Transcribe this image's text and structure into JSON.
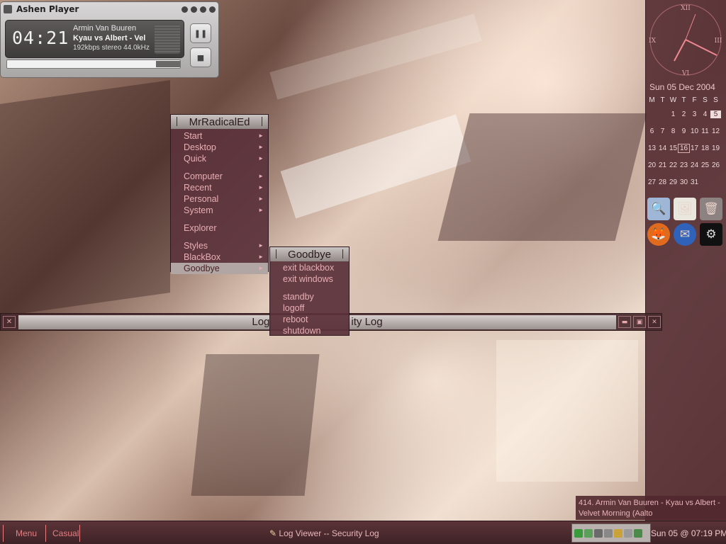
{
  "player": {
    "title": "Ashen Player",
    "time": "04:21",
    "artist": "Armin Van Buuren",
    "track": "Kyau vs Albert - Vel",
    "info": "192kbps stereo 44.0kHz",
    "pause_icon": "pause-icon",
    "stop_icon": "stop-icon",
    "progress": 0.86
  },
  "clock": {
    "numerals": {
      "top": "XII",
      "right": "III",
      "bottom": "VI",
      "left": "IX"
    },
    "date_label": "Sun 05 Dec 2004"
  },
  "calendar": {
    "weekdays": [
      "M",
      "T",
      "W",
      "T",
      "F",
      "S",
      "S"
    ],
    "weeks": [
      [
        "",
        "",
        "",
        "1",
        "2",
        "3",
        "4",
        "5"
      ],
      [
        "6",
        "7",
        "8",
        "9",
        "10",
        "11",
        "12"
      ],
      [
        "13",
        "14",
        "15",
        "16",
        "17",
        "18",
        "19"
      ],
      [
        "20",
        "21",
        "22",
        "23",
        "24",
        "25",
        "26"
      ],
      [
        "27",
        "28",
        "29",
        "30",
        "31",
        "",
        ""
      ]
    ],
    "today": "5",
    "marked": "16"
  },
  "dock": [
    {
      "name": "search-icon",
      "color": "#3a6fb5"
    },
    {
      "name": "image-viewer-icon",
      "color": "#e9e6dd"
    },
    {
      "name": "recycle-bin-icon",
      "color": "#cfcfcf"
    },
    {
      "name": "firefox-icon",
      "color": "#e06b1f"
    },
    {
      "name": "thunderbird-icon",
      "color": "#2f62b8"
    },
    {
      "name": "steam-icon",
      "color": "#111111"
    }
  ],
  "root_menu": {
    "title": "MrRadicalEd",
    "items": [
      {
        "label": "Start",
        "submenu": true
      },
      {
        "label": "Desktop",
        "submenu": true
      },
      {
        "label": "Quick",
        "submenu": true
      },
      {
        "separator": true
      },
      {
        "label": "Computer",
        "submenu": true
      },
      {
        "label": "Recent",
        "submenu": true
      },
      {
        "label": "Personal",
        "submenu": true
      },
      {
        "label": "System",
        "submenu": true
      },
      {
        "separator": true
      },
      {
        "label": "Explorer",
        "submenu": false
      },
      {
        "separator": true
      },
      {
        "label": "Styles",
        "submenu": true
      },
      {
        "label": "BlackBox",
        "submenu": true
      },
      {
        "label": "Goodbye",
        "submenu": true,
        "active": true
      }
    ]
  },
  "goodbye_menu": {
    "title": "Goodbye",
    "items": [
      {
        "label": "exit blackbox"
      },
      {
        "label": "exit windows"
      },
      {
        "separator": true
      },
      {
        "label": "standby"
      },
      {
        "label": "logoff"
      },
      {
        "label": "reboot"
      },
      {
        "label": "shutdown"
      }
    ]
  },
  "log_window": {
    "title_left": "Log",
    "title_right": "ity Log"
  },
  "ticker": {
    "text": "414. Armin Van Buuren - Kyau vs Albert - Velvet Morning (Aalto"
  },
  "taskbar": {
    "menu_label": "Menu",
    "casual_label": "Casual",
    "task_label": "Log Viewer -- Security Log",
    "clock": "Sun 05 @ 07:19 PM"
  },
  "colors": {
    "accent": "#e67e84",
    "panel": "#50282d",
    "menu_text": "#e8aeb4"
  }
}
